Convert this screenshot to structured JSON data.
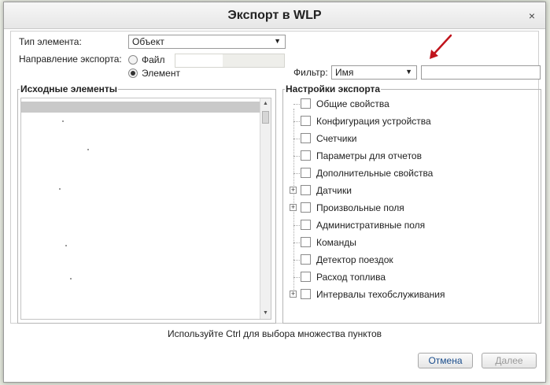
{
  "dialog": {
    "title": "Экспорт в WLP",
    "close_glyph": "×"
  },
  "form": {
    "element_type_label": "Тип элемента:",
    "element_type_value": "Объект",
    "direction_label": "Направление экспорта:",
    "direction_options": [
      {
        "label": "Файл",
        "checked": false
      },
      {
        "label": "Элемент",
        "checked": true
      }
    ],
    "filter_label": "Фильтр:",
    "filter_value": "Имя",
    "filter_text": ""
  },
  "source": {
    "title": "Исходные элементы"
  },
  "settings": {
    "title": "Настройки экспорта",
    "items": [
      {
        "label": "Общие свойства",
        "expandable": false,
        "checked": false
      },
      {
        "label": "Конфигурация устройства",
        "expandable": false,
        "checked": false
      },
      {
        "label": "Счетчики",
        "expandable": false,
        "checked": false
      },
      {
        "label": "Параметры для отчетов",
        "expandable": false,
        "checked": false
      },
      {
        "label": "Дополнительные свойства",
        "expandable": false,
        "checked": false
      },
      {
        "label": "Датчики",
        "expandable": true,
        "checked": false
      },
      {
        "label": "Произвольные поля",
        "expandable": true,
        "checked": false
      },
      {
        "label": "Административные поля",
        "expandable": false,
        "checked": false
      },
      {
        "label": "Команды",
        "expandable": false,
        "checked": false
      },
      {
        "label": "Детектор поездок",
        "expandable": false,
        "checked": false
      },
      {
        "label": "Расход топлива",
        "expandable": false,
        "checked": false
      },
      {
        "label": "Интервалы техобслуживания",
        "expandable": true,
        "checked": false
      }
    ]
  },
  "hint": "Используйте Ctrl для выбора множества пунктов",
  "buttons": {
    "cancel": "Отмена",
    "next": "Далее"
  },
  "icons": {
    "dropdown": "triangle-down-icon",
    "expand": "plus-square-icon",
    "annotation_arrow_color": "#c0141c"
  }
}
